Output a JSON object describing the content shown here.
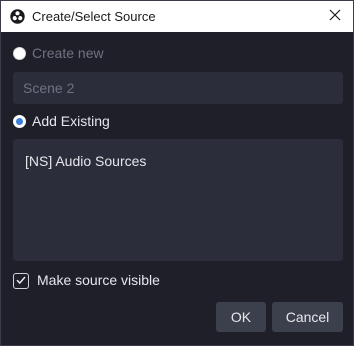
{
  "window": {
    "title": "Create/Select Source",
    "app_icon": "obs-icon",
    "close_icon": "close-icon"
  },
  "create_new": {
    "label": "Create new",
    "selected": false,
    "name_value": "Scene 2",
    "enabled": false
  },
  "add_existing": {
    "label": "Add Existing",
    "selected": true,
    "items": [
      "[NS] Audio Sources"
    ]
  },
  "visibility": {
    "label": "Make source visible",
    "checked": true
  },
  "buttons": {
    "ok": "OK",
    "cancel": "Cancel"
  },
  "colors": {
    "background": "#1e1f29",
    "field": "#2b2d3a",
    "button": "#3c404d",
    "accent": "#3a7fd9"
  }
}
